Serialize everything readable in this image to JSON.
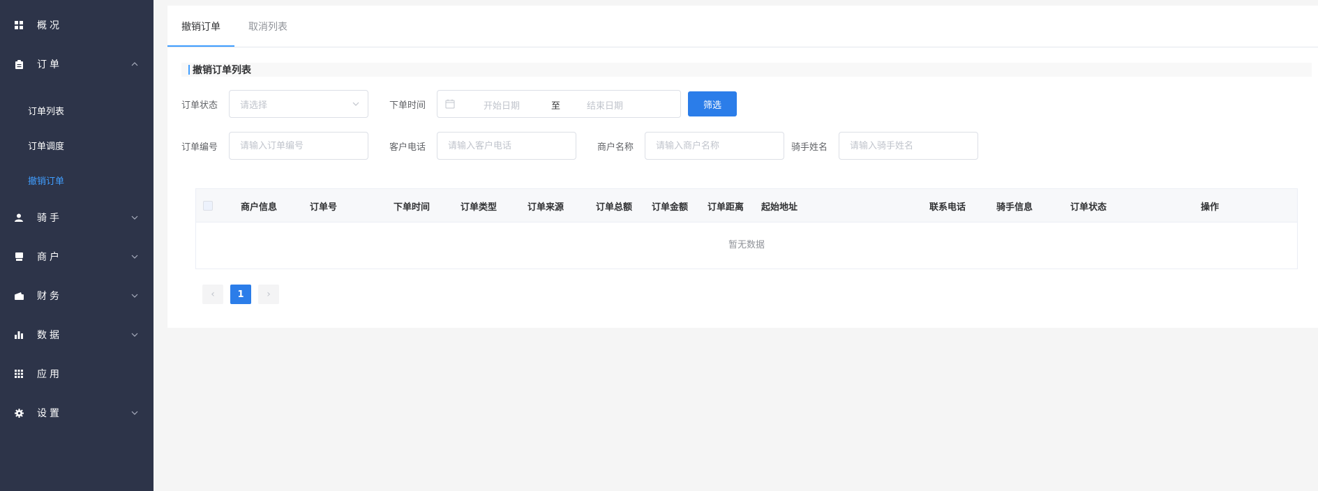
{
  "sidebar": {
    "items": [
      {
        "label": "概况",
        "icon": "dashboard-icon"
      },
      {
        "label": "订单",
        "icon": "clipboard-icon",
        "expanded": true,
        "children": [
          "订单列表",
          "订单调度",
          "撤销订单"
        ]
      },
      {
        "label": "骑手",
        "icon": "user-icon"
      },
      {
        "label": "商户",
        "icon": "store-icon"
      },
      {
        "label": "财务",
        "icon": "wallet-icon"
      },
      {
        "label": "数据",
        "icon": "bar-chart-icon"
      },
      {
        "label": "应用",
        "icon": "grid-icon"
      },
      {
        "label": "设置",
        "icon": "gear-icon"
      }
    ],
    "active_child": "撤销订单"
  },
  "tabs": [
    {
      "label": "撤销订单",
      "active": true
    },
    {
      "label": "取消列表",
      "active": false
    }
  ],
  "section": {
    "title": "撤销订单列表"
  },
  "filters": {
    "order_status_label": "订单状态",
    "order_status_placeholder": "请选择",
    "order_time_label": "下单时间",
    "start_date_placeholder": "开始日期",
    "range_separator": "至",
    "end_date_placeholder": "结束日期",
    "filter_button": "筛选",
    "order_no_label": "订单编号",
    "order_no_placeholder": "请输入订单编号",
    "customer_phone_label": "客户电话",
    "customer_phone_placeholder": "请输入客户电话",
    "merchant_name_label": "商户名称",
    "merchant_name_placeholder": "请输入商户名称",
    "rider_name_label": "骑手姓名",
    "rider_name_placeholder": "请输入骑手姓名"
  },
  "table": {
    "columns": [
      "商户信息",
      "订单号",
      "下单时间",
      "订单类型",
      "订单来源",
      "订单总额",
      "订单金额",
      "订单距离",
      "起始地址",
      "联系电话",
      "骑手信息",
      "订单状态",
      "操作"
    ],
    "empty_text": "暂无数据"
  },
  "pagination": {
    "current_page": "1",
    "prev": "‹",
    "next": "›"
  },
  "colors": {
    "sidebar_bg": "#2d3449",
    "accent": "#409eff",
    "primary_button": "#2b7de9"
  }
}
